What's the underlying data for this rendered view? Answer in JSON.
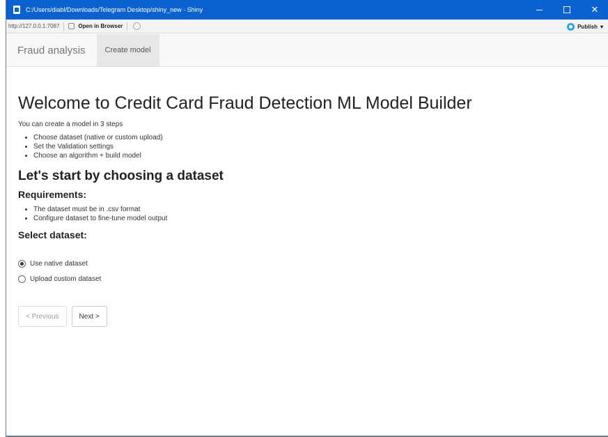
{
  "window": {
    "title": "C:/Users/diabl/Downloads/Telegram Desktop/shiny_new - Shiny",
    "close_glyph": "✕"
  },
  "toolbar": {
    "url": "http://127.0.0.1:7087",
    "open_in_browser": "Open in Browser",
    "publish": "Publish",
    "publish_caret": "▾"
  },
  "navbar": {
    "brand": "Fraud analysis",
    "tabs": [
      {
        "label": "Create model",
        "active": true
      }
    ]
  },
  "main": {
    "title": "Welcome to Credit Card Fraud Detection ML Model Builder",
    "intro": "You can create a model in 3 steps",
    "steps": [
      "Choose dataset (native or custom upload)",
      "Set the Validation settings",
      "Choose an algorithm + build model"
    ],
    "subtitle": "Let's start by choosing a dataset",
    "requirements_heading": "Requirements:",
    "requirements": [
      "The dataset must be in .csv format",
      "Configure dataset to fine-tune model output"
    ],
    "select_heading": "Select dataset:",
    "radio_options": [
      {
        "label": "Use native dataset",
        "checked": true
      },
      {
        "label": "Upload custom dataset",
        "checked": false
      }
    ],
    "buttons": {
      "previous": "< Previous",
      "next": "Next >"
    }
  },
  "colors": {
    "titlebar": "#0a62d0",
    "navbar": "#f8f8f8",
    "active_tab": "#e7e7e7",
    "publish_icon": "#2ea3e0"
  }
}
